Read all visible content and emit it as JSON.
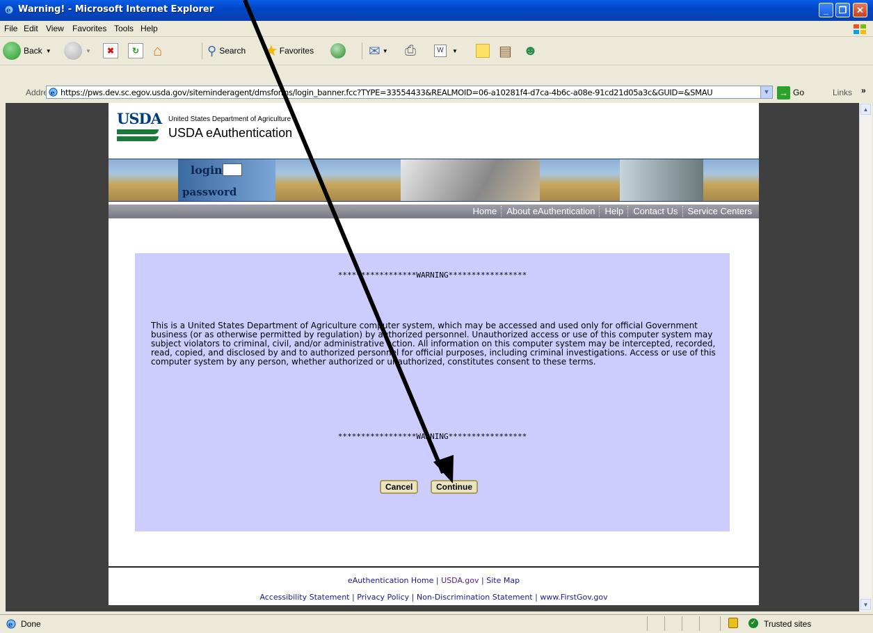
{
  "window": {
    "title": "Warning! - Microsoft Internet Explorer",
    "controls": [
      "minimize",
      "maximize",
      "close"
    ]
  },
  "menu": {
    "items": [
      "File",
      "Edit",
      "View",
      "Favorites",
      "Tools",
      "Help"
    ]
  },
  "toolbar": {
    "back_label": "Back",
    "search_label": "Search",
    "favorites_label": "Favorites"
  },
  "address": {
    "label": "Address",
    "url": "https://pws.dev.sc.egov.usda.gov/siteminderagent/dmsforms/login_banner.fcc?TYPE=33554433&REALMOID=06-a10281f4-d7ca-4b6c-a08e-91cd21d05a3c&GUID=&SMAU",
    "go_label": "Go",
    "links_label": "Links"
  },
  "header": {
    "logo_text": "USDA",
    "dept_text": "United States Department of Agriculture",
    "site_title": "USDA eAuthentication"
  },
  "banner": {
    "login_text": "login:",
    "password_text": "password"
  },
  "nav": {
    "items": [
      "Home",
      "About eAuthentication",
      "Help",
      "Contact Us",
      "Service Centers"
    ]
  },
  "warning": {
    "stars_top": "*****************WARNING*****************",
    "body": "This is a United States Department of Agriculture computer system, which may be accessed and used only for official Government business (or as otherwise permitted by regulation) by authorized personnel. Unauthorized access or use of this computer system may subject violators to criminal, civil, and/or administrative action. All information on this computer system may be intercepted, recorded, read, copied, and disclosed by and to authorized personnel for official purposes, including criminal investigations. Access or use of this computer system by any person, whether authorized or unauthorized, constitutes consent to these terms.",
    "stars_bottom": "*****************WARNING*****************",
    "cancel_label": "Cancel",
    "continue_label": "Continue"
  },
  "footer": {
    "row1": [
      "eAuthentication Home",
      "USDA.gov",
      "Site Map"
    ],
    "row2": [
      "Accessibility Statement",
      "Privacy Policy",
      "Non-Discrimination Statement",
      "www.FirstGov.gov"
    ],
    "separator": "|"
  },
  "status": {
    "left": "Done",
    "zone": "Trusted sites"
  },
  "colors": {
    "warning_bg": "#ccccff",
    "titlebar": "#0047c8",
    "usda_green": "#1a7a3c",
    "usda_blue": "#003d7c"
  }
}
